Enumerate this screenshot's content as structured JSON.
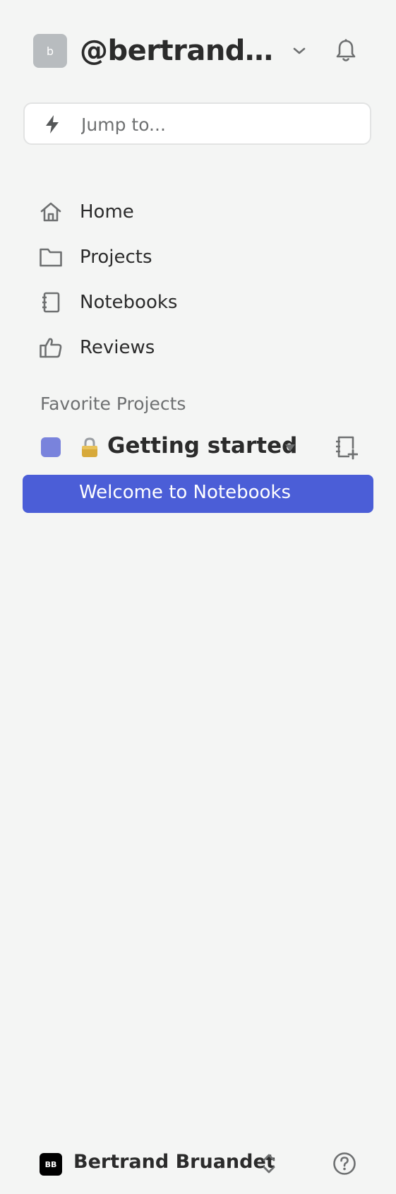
{
  "workspace": {
    "avatar_letter": "b",
    "name": "@bertrandbruandet"
  },
  "search": {
    "placeholder": "Jump to..."
  },
  "nav": {
    "items": [
      {
        "label": "Home",
        "icon": "home-icon"
      },
      {
        "label": "Projects",
        "icon": "folder-icon"
      },
      {
        "label": "Notebooks",
        "icon": "notebook-icon"
      },
      {
        "label": "Reviews",
        "icon": "thumbs-up-icon"
      }
    ]
  },
  "favorites": {
    "title": "Favorite Projects",
    "project": {
      "name": "Getting started",
      "lock_icon": "lock-icon",
      "color": "#7983dc"
    },
    "notebooks": [
      {
        "label": "Welcome to Notebooks"
      }
    ]
  },
  "user": {
    "initials": "BB",
    "name": "Bertrand Bruandet"
  },
  "colors": {
    "background": "#f4f5f4",
    "accent": "#4b5ed7",
    "text": "#2b2b2b",
    "muted": "#6e7071"
  }
}
